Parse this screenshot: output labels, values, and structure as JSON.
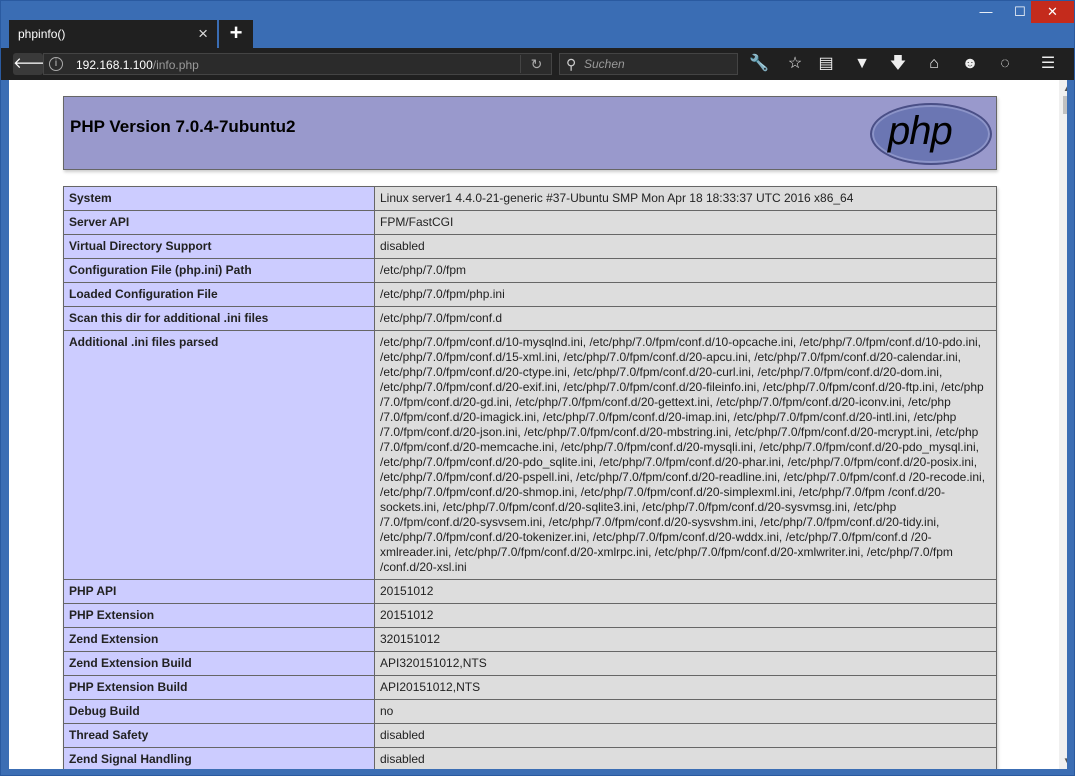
{
  "browser": {
    "tab_title": "phpinfo()",
    "new_tab": "+",
    "url_host": "192.168.1.100",
    "url_path": "/info.php",
    "search_placeholder": "Suchen",
    "window_controls": {
      "minimize": "—",
      "maximize": "☐",
      "close": "✕"
    }
  },
  "phpinfo": {
    "title": "PHP Version 7.0.4-7ubuntu2",
    "logo_text": "php",
    "rows": [
      {
        "key": "System",
        "value": "Linux server1 4.4.0-21-generic #37-Ubuntu SMP Mon Apr 18 18:33:37 UTC 2016 x86_64"
      },
      {
        "key": "Server API",
        "value": "FPM/FastCGI"
      },
      {
        "key": "Virtual Directory Support",
        "value": "disabled"
      },
      {
        "key": "Configuration File (php.ini) Path",
        "value": "/etc/php/7.0/fpm"
      },
      {
        "key": "Loaded Configuration File",
        "value": "/etc/php/7.0/fpm/php.ini"
      },
      {
        "key": "Scan this dir for additional .ini files",
        "value": "/etc/php/7.0/fpm/conf.d"
      },
      {
        "key": "Additional .ini files parsed",
        "value": "/etc/php/7.0/fpm/conf.d/10-mysqlnd.ini, /etc/php/7.0/fpm/conf.d/10-opcache.ini, /etc/php/7.0/fpm/conf.d/10-pdo.ini, /etc/php/7.0/fpm/conf.d/15-xml.ini, /etc/php/7.0/fpm/conf.d/20-apcu.ini, /etc/php/7.0/fpm/conf.d/20-calendar.ini, /etc/php/7.0/fpm/conf.d/20-ctype.ini, /etc/php/7.0/fpm/conf.d/20-curl.ini, /etc/php/7.0/fpm/conf.d/20-dom.ini, /etc/php/7.0/fpm/conf.d/20-exif.ini, /etc/php/7.0/fpm/conf.d/20-fileinfo.ini, /etc/php/7.0/fpm/conf.d/20-ftp.ini, /etc/php /7.0/fpm/conf.d/20-gd.ini, /etc/php/7.0/fpm/conf.d/20-gettext.ini, /etc/php/7.0/fpm/conf.d/20-iconv.ini, /etc/php /7.0/fpm/conf.d/20-imagick.ini, /etc/php/7.0/fpm/conf.d/20-imap.ini, /etc/php/7.0/fpm/conf.d/20-intl.ini, /etc/php /7.0/fpm/conf.d/20-json.ini, /etc/php/7.0/fpm/conf.d/20-mbstring.ini, /etc/php/7.0/fpm/conf.d/20-mcrypt.ini, /etc/php /7.0/fpm/conf.d/20-memcache.ini, /etc/php/7.0/fpm/conf.d/20-mysqli.ini, /etc/php/7.0/fpm/conf.d/20-pdo_mysql.ini, /etc/php/7.0/fpm/conf.d/20-pdo_sqlite.ini, /etc/php/7.0/fpm/conf.d/20-phar.ini, /etc/php/7.0/fpm/conf.d/20-posix.ini, /etc/php/7.0/fpm/conf.d/20-pspell.ini, /etc/php/7.0/fpm/conf.d/20-readline.ini, /etc/php/7.0/fpm/conf.d /20-recode.ini, /etc/php/7.0/fpm/conf.d/20-shmop.ini, /etc/php/7.0/fpm/conf.d/20-simplexml.ini, /etc/php/7.0/fpm /conf.d/20-sockets.ini, /etc/php/7.0/fpm/conf.d/20-sqlite3.ini, /etc/php/7.0/fpm/conf.d/20-sysvmsg.ini, /etc/php /7.0/fpm/conf.d/20-sysvsem.ini, /etc/php/7.0/fpm/conf.d/20-sysvshm.ini, /etc/php/7.0/fpm/conf.d/20-tidy.ini, /etc/php/7.0/fpm/conf.d/20-tokenizer.ini, /etc/php/7.0/fpm/conf.d/20-wddx.ini, /etc/php/7.0/fpm/conf.d /20-xmlreader.ini, /etc/php/7.0/fpm/conf.d/20-xmlrpc.ini, /etc/php/7.0/fpm/conf.d/20-xmlwriter.ini, /etc/php/7.0/fpm /conf.d/20-xsl.ini"
      },
      {
        "key": "PHP API",
        "value": "20151012"
      },
      {
        "key": "PHP Extension",
        "value": "20151012"
      },
      {
        "key": "Zend Extension",
        "value": "320151012"
      },
      {
        "key": "Zend Extension Build",
        "value": "API320151012,NTS"
      },
      {
        "key": "PHP Extension Build",
        "value": "API20151012,NTS"
      },
      {
        "key": "Debug Build",
        "value": "no"
      },
      {
        "key": "Thread Safety",
        "value": "disabled"
      },
      {
        "key": "Zend Signal Handling",
        "value": "disabled"
      }
    ]
  },
  "colors": {
    "header_bg": "#9999cc",
    "key_bg": "#ccccff",
    "value_bg": "#dddddd",
    "titlebar": "#3a6db4",
    "toolbar": "#202020"
  }
}
